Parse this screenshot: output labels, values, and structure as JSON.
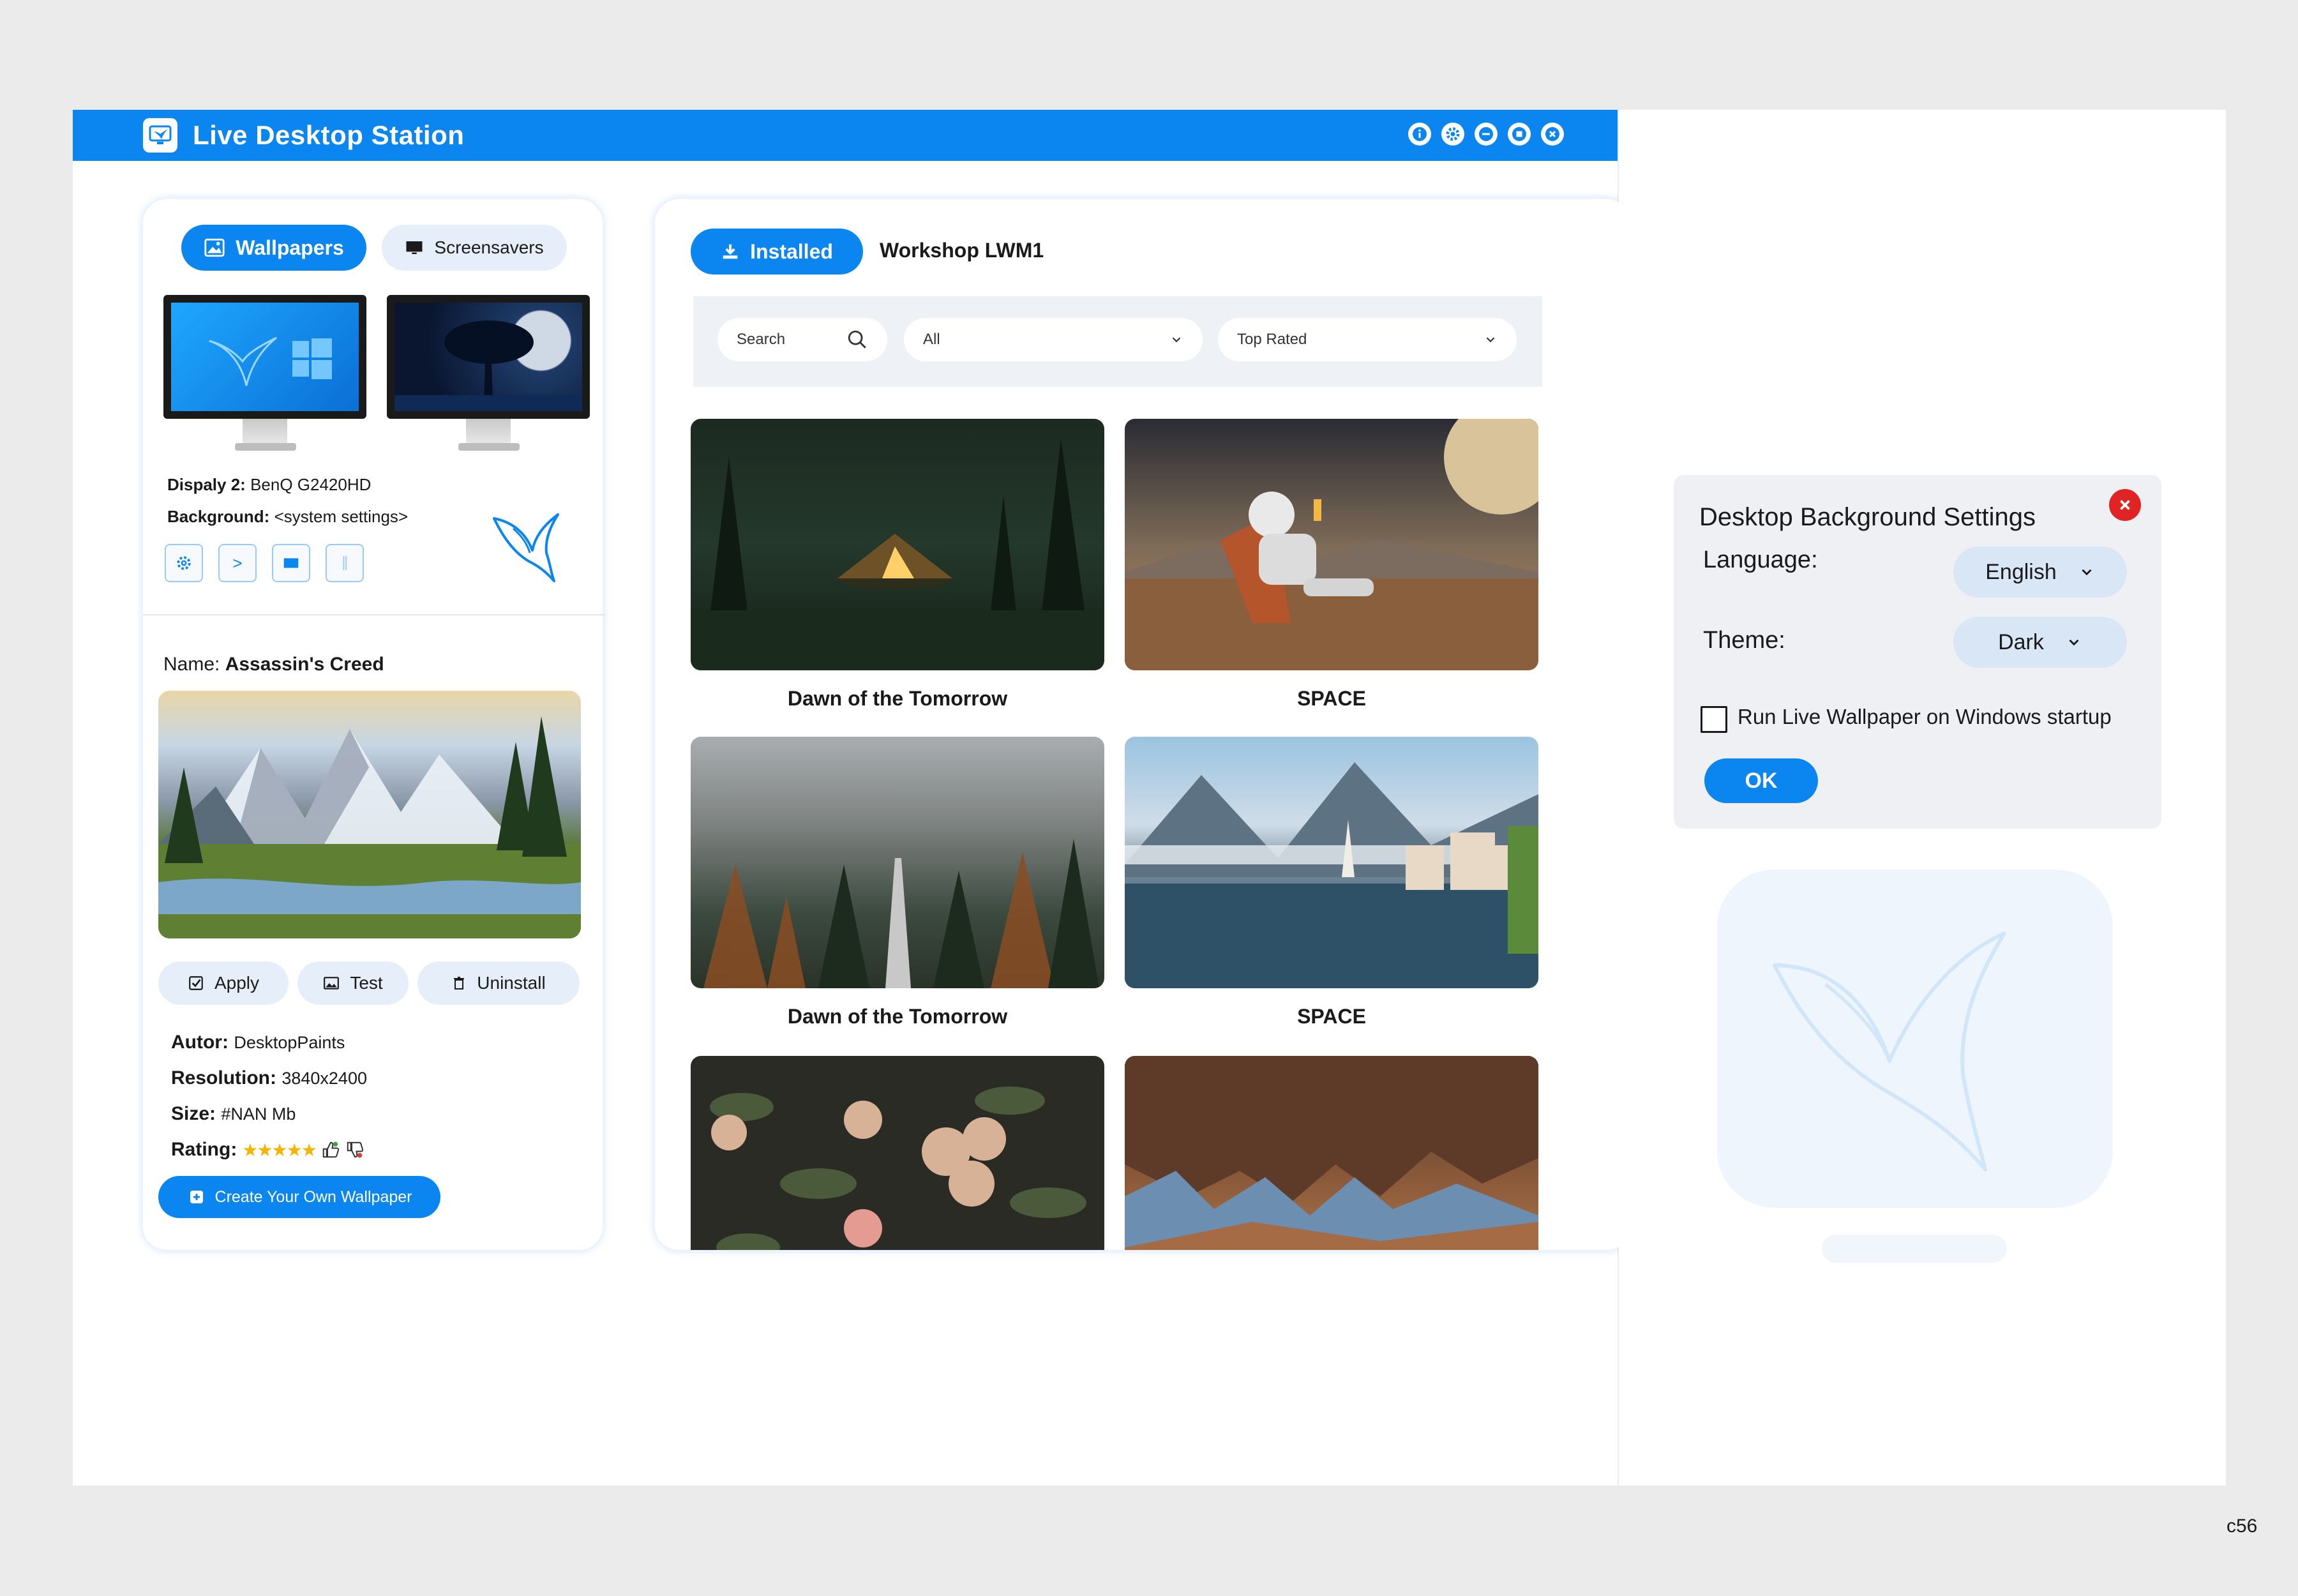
{
  "window": {
    "title": "Live Desktop Station",
    "controls": [
      "info-icon",
      "gear-icon",
      "minimize-icon",
      "maximize-icon",
      "close-icon"
    ]
  },
  "sidebar": {
    "tabs": [
      {
        "label": "Wallpapers",
        "icon": "wallpaper-icon",
        "active": true
      },
      {
        "label": "Screensavers",
        "icon": "monitor-icon",
        "active": false
      }
    ],
    "display_label": "Dispaly 2:",
    "display_value": "BenQ G2420HD",
    "background_label": "Background:",
    "background_value": "<system settings>",
    "tools": [
      "gear-icon",
      "next-icon",
      "fill-icon",
      "split-icon"
    ],
    "tool_next_glyph": ">",
    "name_label": "Name:",
    "name_value": "Assassin's Creed",
    "actions": {
      "apply": "Apply",
      "test": "Test",
      "uninstall": "Uninstall"
    },
    "author_label": "Autor:",
    "author_value": "DesktopPaints",
    "resolution_label": "Resolution:",
    "resolution_value": "3840x2400",
    "size_label": "Size:",
    "size_value": "#NAN Mb",
    "rating_label": "Rating:",
    "rating_stars": 5,
    "rating_glyph": "★★★★★",
    "create_button": "Create Your Own Wallpaper"
  },
  "gallery": {
    "tabs": {
      "installed": "Installed",
      "workshop": "Workshop LWM1"
    },
    "search_placeholder": "Search",
    "category_value": "All",
    "sort_value": "Top Rated",
    "items": [
      {
        "title": "Dawn of the Tomorrow"
      },
      {
        "title": "SPACE"
      },
      {
        "title": "Dawn of the Tomorrow"
      },
      {
        "title": "SPACE"
      },
      {
        "title": ""
      },
      {
        "title": ""
      }
    ]
  },
  "dialog": {
    "title": "Desktop Background Settings",
    "language_label": "Language:",
    "language_value": "English",
    "theme_label": "Theme:",
    "theme_value": "Dark",
    "startup_label": "Run Live Wallpaper on Windows startup",
    "startup_checked": false,
    "ok": "OK"
  },
  "corner_label": "c56",
  "colors": {
    "accent": "#0b86f1",
    "close": "#e02424",
    "soft": "#e6eff9",
    "star": "#f5b400"
  }
}
